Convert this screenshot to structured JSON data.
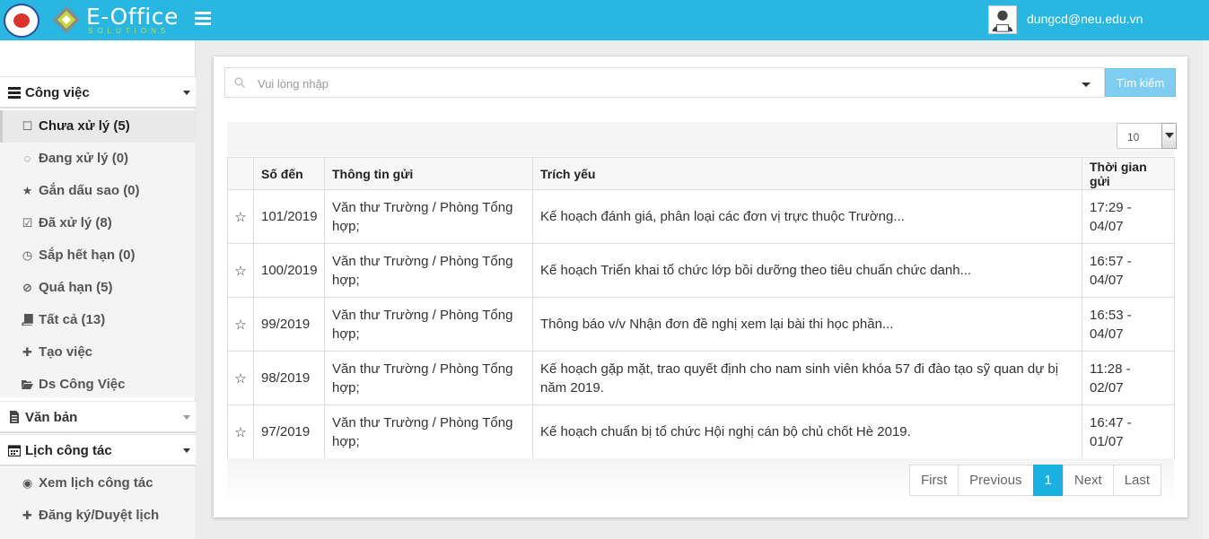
{
  "header": {
    "brand": "E-Office",
    "brand_sub": "SOLUTIONS",
    "user_email": "dungcd@neu.edu.vn",
    "bg_color": "#29b6e0"
  },
  "sidebar": {
    "groups": [
      {
        "label": "Công việc",
        "icon": "list-icon"
      },
      {
        "label": "Văn bản",
        "icon": "document-icon"
      },
      {
        "label": "Lịch công tác",
        "icon": "calendar-icon"
      }
    ],
    "work_items": [
      {
        "label": "Chưa xử lý (5)",
        "icon": "square-icon",
        "active": true
      },
      {
        "label": "Đang xử lý (0)",
        "icon": "spinner-icon"
      },
      {
        "label": "Gắn dấu sao (0)",
        "icon": "star-icon"
      },
      {
        "label": "Đã xử lý (8)",
        "icon": "check-square-icon"
      },
      {
        "label": "Sắp hết hạn (0)",
        "icon": "clock-icon"
      },
      {
        "label": "Quá hạn (5)",
        "icon": "ban-icon"
      },
      {
        "label": "Tất cả (13)",
        "icon": "book-icon"
      },
      {
        "label": "Tạo việc",
        "icon": "plus-icon"
      },
      {
        "label": "Ds Công Việc",
        "icon": "folder-open-icon"
      }
    ],
    "calendar_items": [
      {
        "label": "Xem lịch công tác",
        "icon": "eye-icon"
      },
      {
        "label": "Đăng ký/Duyệt lịch",
        "icon": "plus-icon"
      }
    ]
  },
  "search": {
    "placeholder": "Vui lòng nhập",
    "value": "",
    "button_label": "Tìm kiếm"
  },
  "page_size": "10",
  "table": {
    "columns": [
      "",
      "Số đến",
      "Thông tin gửi",
      "Trích yếu",
      "Thời gian gửi"
    ],
    "rows": [
      {
        "so_den": "101/2019",
        "thong_tin_1": "Văn thư Trường / Phòng Tổng",
        "thong_tin_2": "hợp;",
        "trich_yeu_1": "Kế hoạch đánh giá, phân loại các đơn vị trực thuộc Trường...",
        "trich_yeu_2": "",
        "time_1": "17:29 -",
        "time_2": "04/07"
      },
      {
        "so_den": "100/2019",
        "thong_tin_1": "Văn thư Trường / Phòng Tổng",
        "thong_tin_2": "hợp;",
        "trich_yeu_1": "Kế hoạch Triển khai tổ chức lớp bồi dưỡng theo tiêu chuẩn chức danh...",
        "trich_yeu_2": "",
        "time_1": "16:57 -",
        "time_2": "04/07"
      },
      {
        "so_den": "99/2019",
        "thong_tin_1": "Văn thư Trường / Phòng Tổng",
        "thong_tin_2": "hợp;",
        "trich_yeu_1": "Thông báo v/v Nhận đơn đề nghị xem lại bài thi học phần...",
        "trich_yeu_2": "",
        "time_1": "16:53 -",
        "time_2": "04/07"
      },
      {
        "so_den": "98/2019",
        "thong_tin_1": "Văn thư Trường / Phòng Tổng",
        "thong_tin_2": "hợp;",
        "trich_yeu_1": "Kế hoạch gặp mặt, trao quyết định cho nam sinh viên khóa 57 đi đào tạo sỹ quan dự bị",
        "trich_yeu_2": "năm 2019.",
        "time_1": "11:28 -",
        "time_2": "02/07"
      },
      {
        "so_den": "97/2019",
        "thong_tin_1": "Văn thư Trường / Phòng Tổng",
        "thong_tin_2": "hợp;",
        "trich_yeu_1": "Kế hoạch chuẩn bị tổ chức Hội nghị cán bộ chủ chốt Hè 2019.",
        "trich_yeu_2": "",
        "time_1": "16:47 -",
        "time_2": "01/07"
      }
    ]
  },
  "pagination": {
    "first": "First",
    "previous": "Previous",
    "current": "1",
    "next": "Next",
    "last": "Last",
    "accent": "#1ab0e2"
  }
}
